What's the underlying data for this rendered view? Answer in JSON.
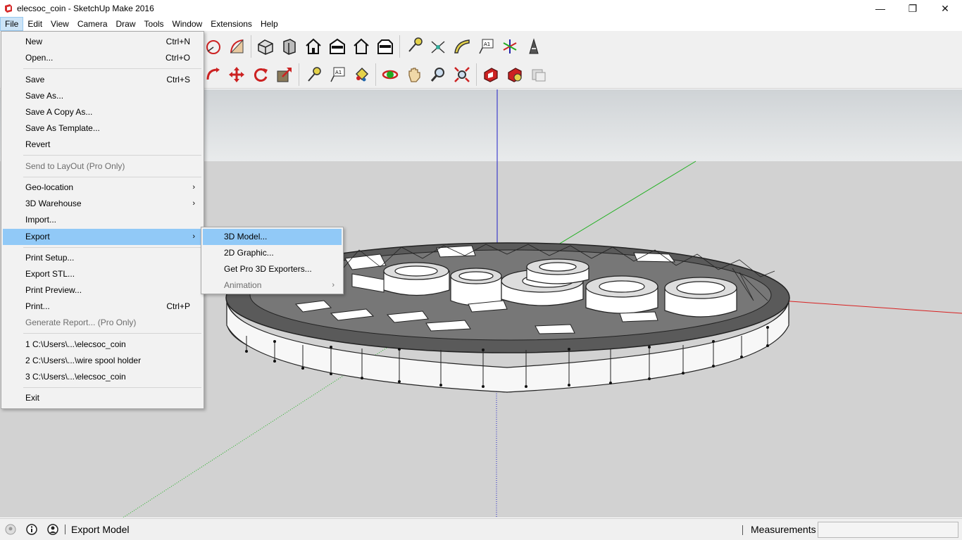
{
  "window": {
    "title": "elecsoc_coin - SketchUp Make 2016",
    "minimize_glyph": "—",
    "maximize_glyph": "❐",
    "close_glyph": "✕"
  },
  "menubar": {
    "items": [
      "File",
      "Edit",
      "View",
      "Camera",
      "Draw",
      "Tools",
      "Window",
      "Extensions",
      "Help"
    ],
    "active_index": 0
  },
  "file_menu": {
    "items": [
      {
        "label": "New",
        "shortcut": "Ctrl+N"
      },
      {
        "label": "Open...",
        "shortcut": "Ctrl+O"
      },
      {
        "label": "Save",
        "shortcut": "Ctrl+S"
      },
      {
        "label": "Save As...",
        "shortcut": ""
      },
      {
        "label": "Save A Copy As...",
        "shortcut": ""
      },
      {
        "label": "Save As Template...",
        "shortcut": ""
      },
      {
        "label": "Revert",
        "shortcut": ""
      },
      {
        "label": "Send to LayOut (Pro Only)",
        "shortcut": ""
      },
      {
        "label": "Geo-location",
        "shortcut": ""
      },
      {
        "label": "3D Warehouse",
        "shortcut": ""
      },
      {
        "label": "Import...",
        "shortcut": ""
      },
      {
        "label": "Export",
        "shortcut": ""
      },
      {
        "label": "Print Setup...",
        "shortcut": ""
      },
      {
        "label": "Export STL...",
        "shortcut": ""
      },
      {
        "label": "Print Preview...",
        "shortcut": ""
      },
      {
        "label": "Print...",
        "shortcut": "Ctrl+P"
      },
      {
        "label": "Generate Report... (Pro Only)",
        "shortcut": ""
      },
      {
        "label": "1 C:\\Users\\...\\elecsoc_coin",
        "shortcut": ""
      },
      {
        "label": "2 C:\\Users\\...\\wire spool holder",
        "shortcut": ""
      },
      {
        "label": "3 C:\\Users\\...\\elecsoc_coin",
        "shortcut": ""
      },
      {
        "label": "Exit",
        "shortcut": ""
      }
    ],
    "submenu_arrow": "›"
  },
  "export_submenu": {
    "items": [
      {
        "label": "3D Model..."
      },
      {
        "label": "2D Graphic..."
      },
      {
        "label": "Get Pro 3D Exporters..."
      },
      {
        "label": "Animation"
      }
    ]
  },
  "statusbar": {
    "text": "Export Model",
    "measurements_label": "Measurements",
    "measurements_value": ""
  },
  "colors": {
    "sky_top": "#cfd3d6",
    "sky_bottom": "#e9ebec",
    "ground": "#d2d2d2",
    "axis_red": "#d82020",
    "axis_green": "#20b020",
    "axis_blue": "#2020c8",
    "menu_highlight": "#91c9f7"
  }
}
